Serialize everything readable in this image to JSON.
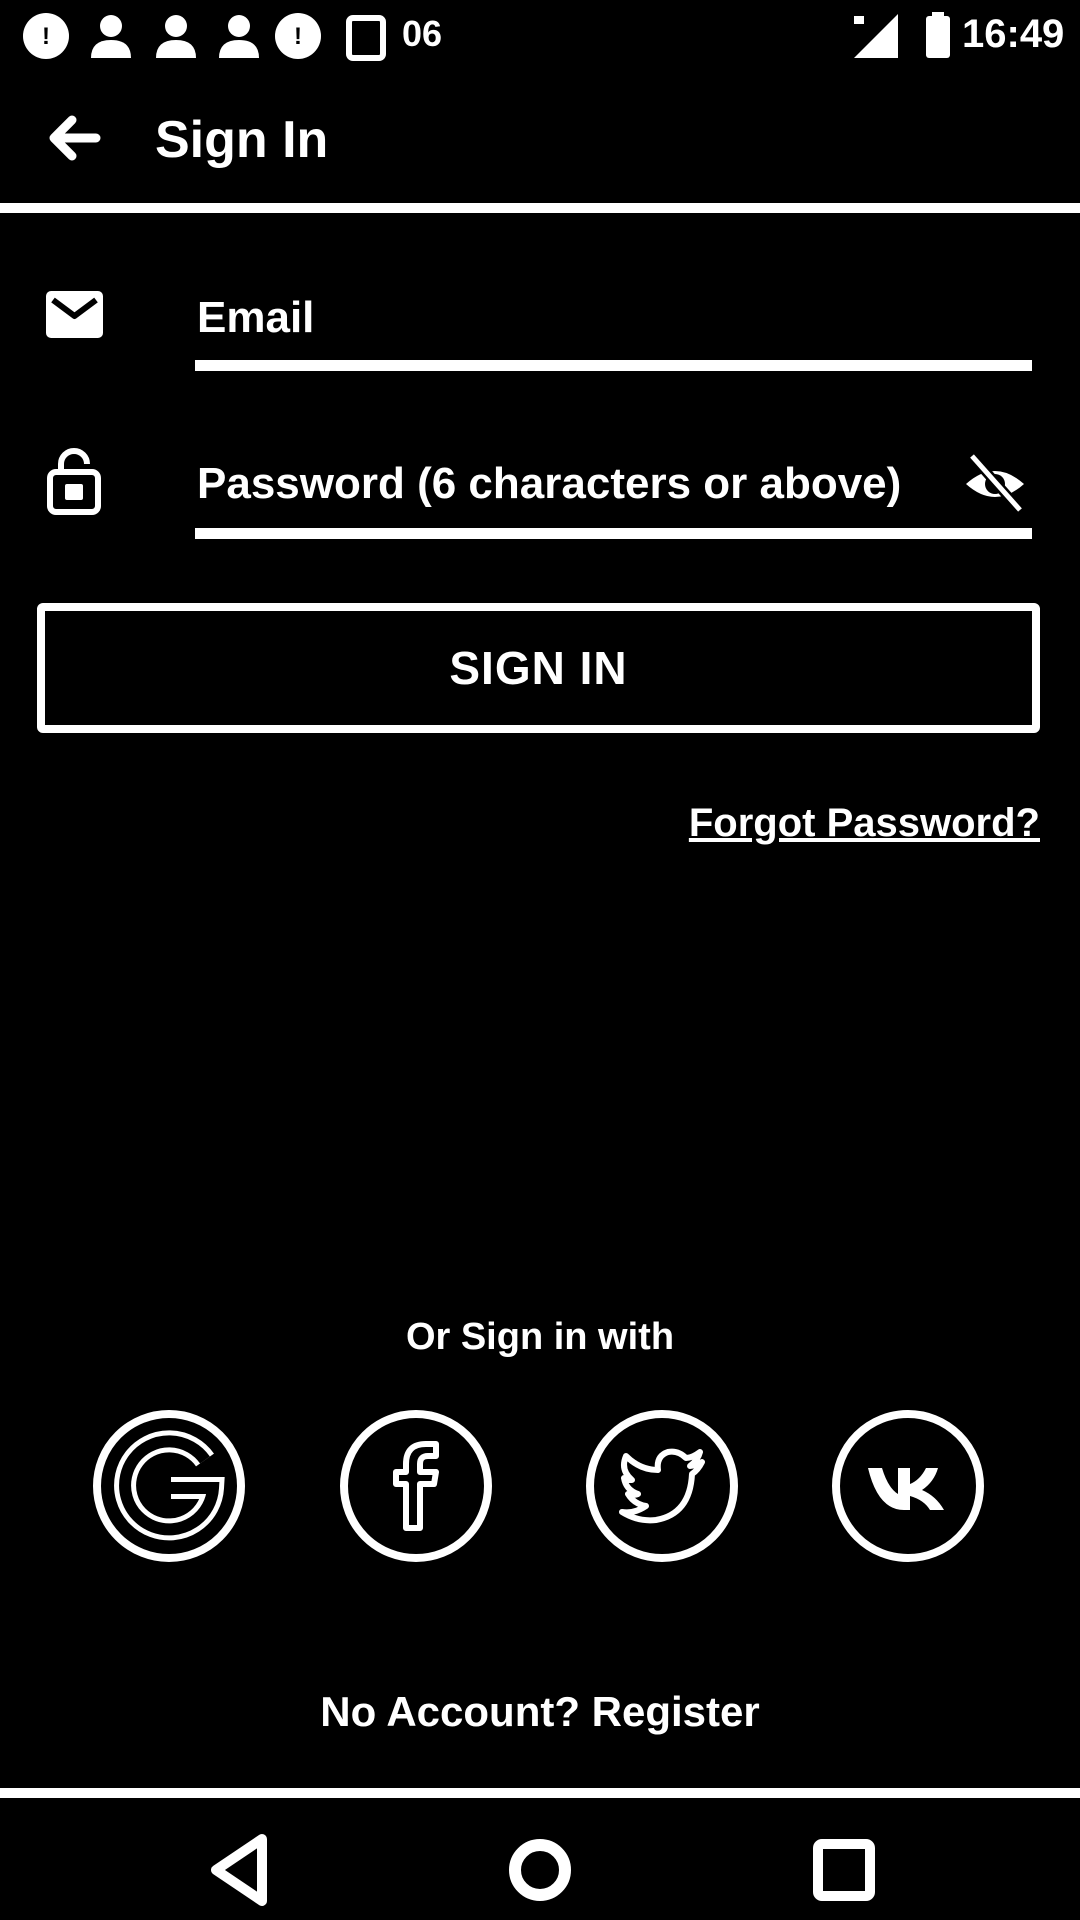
{
  "status_bar": {
    "time": "16:49",
    "extra": "06",
    "icons": [
      "alert-icon",
      "person-icon",
      "person-icon",
      "person-icon",
      "alert-icon",
      "sd-card-icon",
      "signal-icon",
      "battery-icon"
    ]
  },
  "app_bar": {
    "title": "Sign In",
    "back_icon": "arrow-back-icon"
  },
  "form": {
    "email": {
      "placeholder": "Email",
      "value": "",
      "icon": "mail-icon"
    },
    "password": {
      "placeholder": "Password (6 characters or above)",
      "value": "",
      "icon": "lock-icon",
      "toggle_icon": "eye-off-icon"
    },
    "sign_in_label": "SIGN IN",
    "forgot_password": "Forgot Password?"
  },
  "social": {
    "heading": "Or Sign in with",
    "providers": [
      "google",
      "facebook",
      "twitter",
      "vk"
    ]
  },
  "footer": {
    "register": "No Account? Register"
  },
  "colors": {
    "background": "#000000",
    "foreground": "#ffffff"
  }
}
